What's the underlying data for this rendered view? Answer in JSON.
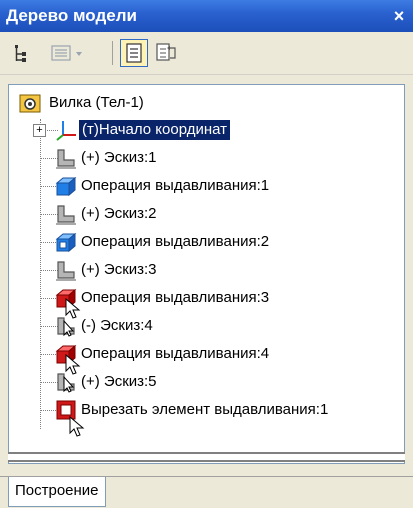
{
  "window": {
    "title": "Дерево модели",
    "close_glyph": "×"
  },
  "toolbar": {
    "buttons": [
      {
        "name": "tree-structure-icon",
        "active": false
      },
      {
        "name": "list-view-icon",
        "active": false,
        "has_dropdown": true
      },
      {
        "name": "construction-order-icon",
        "active": true
      },
      {
        "name": "relations-icon",
        "active": false
      }
    ]
  },
  "tree": {
    "root_label": "Вилка (Тел-1)",
    "items": [
      {
        "label": "(т)Начало координат",
        "icon": "origin-axes-icon",
        "selected": true,
        "expandable": true
      },
      {
        "label": "(+) Эскиз:1",
        "icon": "sketch-icon"
      },
      {
        "label": "Операция выдавливания:1",
        "icon": "extrude-blue-icon"
      },
      {
        "label": "(+) Эскиз:2",
        "icon": "sketch-icon"
      },
      {
        "label": "Операция выдавливания:2",
        "icon": "extrude-blue-icon"
      },
      {
        "label": "(+) Эскиз:3",
        "icon": "sketch-icon"
      },
      {
        "label": "Операция выдавливания:3",
        "icon": "extrude-red-icon"
      },
      {
        "label": "(-) Эскиз:4",
        "icon": "sketch-cursor-icon"
      },
      {
        "label": "Операция выдавливания:4",
        "icon": "extrude-red-icon"
      },
      {
        "label": "(+) Эскиз:5",
        "icon": "sketch-cursor-icon"
      },
      {
        "label": "Вырезать элемент выдавливания:1",
        "icon": "cut-extrude-icon"
      }
    ]
  },
  "tabs": {
    "active": "Построение"
  },
  "colors": {
    "title_bar": "#2a62d0",
    "selection": "#0a246a",
    "extrude_blue": "#1f7fe6",
    "extrude_red": "#d01818"
  }
}
